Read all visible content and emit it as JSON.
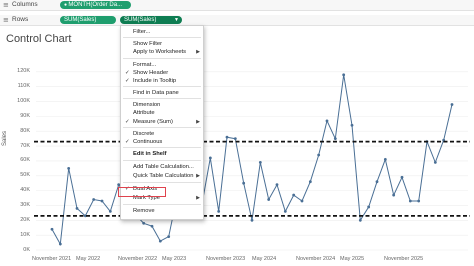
{
  "shelves": {
    "columns": {
      "label": "Columns",
      "pill": "MONTH(Order Da..."
    },
    "rows": {
      "label": "Rows",
      "pills": [
        "SUM(Sales)",
        "SUM(Sales)"
      ]
    }
  },
  "sheet_title": "Control Chart",
  "icons": {
    "columns": "columns-icon",
    "rows": "rows-icon",
    "pill_continuous": "calendar-icon",
    "pill_dropdown": "chevron-down-icon",
    "check": "checkmark-icon",
    "submenu": "chevron-right-icon"
  },
  "colors": {
    "pill": "#1f9e6e",
    "line": "#4a6f95",
    "control_limits": "#111111",
    "highlight": "#e0424d"
  },
  "context_menu": {
    "items": [
      {
        "label": "Filter...",
        "checked": false,
        "submenu": false
      },
      {
        "label": "Show Filter",
        "checked": false,
        "submenu": false
      },
      {
        "label": "Apply to Worksheets",
        "checked": false,
        "submenu": true
      },
      {
        "label": "Format...",
        "checked": false,
        "submenu": false
      },
      {
        "label": "Show Header",
        "checked": true,
        "submenu": false
      },
      {
        "label": "Include in Tooltip",
        "checked": true,
        "submenu": false
      },
      {
        "label": "Find in Data pane",
        "checked": false,
        "submenu": false
      },
      {
        "label": "Dimension",
        "checked": false,
        "submenu": false
      },
      {
        "label": "Attribute",
        "checked": false,
        "submenu": false
      },
      {
        "label": "Measure (Sum)",
        "checked": true,
        "submenu": true
      },
      {
        "label": "Discrete",
        "checked": false,
        "submenu": false
      },
      {
        "label": "Continuous",
        "checked": true,
        "submenu": false
      },
      {
        "label": "Edit in Shelf",
        "checked": false,
        "submenu": false
      },
      {
        "label": "Add Table Calculation...",
        "checked": false,
        "submenu": false
      },
      {
        "label": "Quick Table Calculation",
        "checked": false,
        "submenu": true
      },
      {
        "label": "Dual Axis",
        "checked": true,
        "submenu": false
      },
      {
        "label": "Mark Type",
        "checked": false,
        "submenu": true
      },
      {
        "label": "Remove",
        "checked": false,
        "submenu": false
      }
    ]
  },
  "chart_data": {
    "type": "line",
    "title": "Control Chart",
    "ylabel": "Sales",
    "ylim": [
      0,
      130000
    ],
    "y_ticks": [
      "0K",
      "10K",
      "20K",
      "30K",
      "40K",
      "50K",
      "60K",
      "70K",
      "80K",
      "90K",
      "100K",
      "110K",
      "120K"
    ],
    "x_ticks": [
      "November 2021",
      "May 2022",
      "November 2022",
      "May 2023",
      "November 2023",
      "May 2024",
      "November 2024",
      "May 2025",
      "November 2025"
    ],
    "reference_lines": [
      73000,
      23000
    ],
    "series": [
      {
        "x": [
          "2021-11",
          "2021-12",
          "2022-01",
          "2022-02",
          "2022-03",
          "2022-04",
          "2022-05",
          "2022-06",
          "2022-07",
          "2022-08",
          "2022-09",
          "2022-10",
          "2022-11",
          "2022-12",
          "2023-01",
          "2023-02",
          "2023-03",
          "2023-04",
          "2023-05",
          "2023-06",
          "2023-07",
          "2023-08",
          "2023-09",
          "2023-10",
          "2023-11",
          "2023-12",
          "2024-01",
          "2024-02",
          "2024-03",
          "2024-04",
          "2024-05",
          "2024-06",
          "2024-07",
          "2024-08",
          "2024-09",
          "2024-10",
          "2024-11",
          "2024-12",
          "2025-01",
          "2025-02",
          "2025-03",
          "2025-04",
          "2025-05",
          "2025-06",
          "2025-07",
          "2025-08",
          "2025-09",
          "2025-10",
          "2025-11",
          "2025-12"
        ],
        "values": [
          14000,
          4000,
          55000,
          28000,
          23000,
          34000,
          33000,
          26000,
          44000,
          36000,
          24000,
          18000,
          16000,
          6000,
          9000,
          36000,
          44000,
          28000,
          31000,
          62000,
          26000,
          76000,
          75000,
          45000,
          20000,
          59000,
          34000,
          44000,
          26000,
          37000,
          33000,
          46000,
          64000,
          87000,
          75000,
          118000,
          84000,
          20000,
          29000,
          46000,
          61000,
          37000,
          49000,
          33000,
          33000,
          73000,
          59000,
          74000,
          98000,
          null
        ]
      }
    ]
  }
}
